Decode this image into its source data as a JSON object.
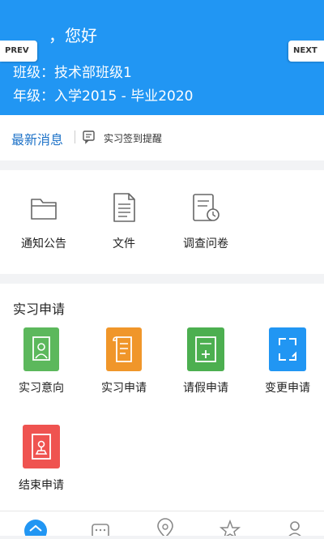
{
  "header": {
    "greeting": "，您好",
    "class_line": "班级：技术部班级1",
    "grade_line": "年级：入学2015 - 毕业2020",
    "prev_label": "PREV",
    "next_label": "NEXT"
  },
  "news": {
    "title": "最新消息",
    "message": "实习签到提醒",
    "icon": "message-icon"
  },
  "quick": [
    {
      "label": "通知公告",
      "icon": "folder-icon"
    },
    {
      "label": "文件",
      "icon": "file-icon"
    },
    {
      "label": "调查问卷",
      "icon": "survey-icon"
    }
  ],
  "internship": {
    "title": "实习申请",
    "items": [
      {
        "label": "实习意向",
        "icon": "intention-icon",
        "color": "#5cb85c"
      },
      {
        "label": "实习申请",
        "icon": "application-icon",
        "color": "#f0962a"
      },
      {
        "label": "请假申请",
        "icon": "leave-icon",
        "color": "#4caf50"
      },
      {
        "label": "变更申请",
        "icon": "change-icon",
        "color": "#2196f3"
      },
      {
        "label": "结束申请",
        "icon": "end-icon",
        "color": "#ef5350"
      }
    ]
  },
  "tabbar": {
    "tabs": [
      {
        "icon": "home-icon",
        "active": true
      },
      {
        "icon": "chat-icon"
      },
      {
        "icon": "location-icon"
      },
      {
        "icon": "star-icon"
      },
      {
        "icon": "profile-icon"
      }
    ],
    "active_color": "#2196f3"
  }
}
